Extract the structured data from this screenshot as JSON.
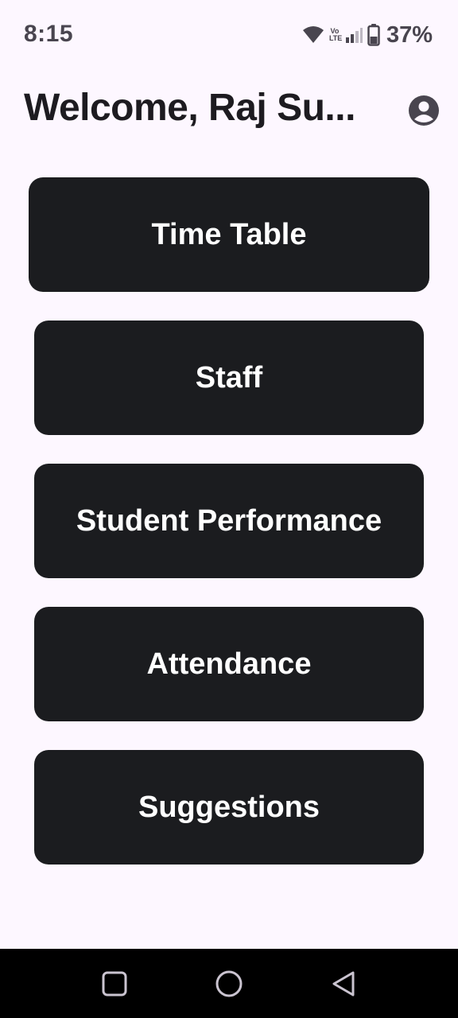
{
  "status_bar": {
    "time": "8:15",
    "volte_line1": "Vo",
    "volte_line2": "LTE",
    "battery_percent": "37%",
    "icons": [
      "wifi-icon",
      "volte-icon",
      "signal-icon",
      "battery-icon"
    ]
  },
  "header": {
    "title": "Welcome, Raj Su...",
    "account_icon": "account-circle-icon"
  },
  "menu": {
    "items": [
      {
        "label": "Time Table"
      },
      {
        "label": "Staff"
      },
      {
        "label": "Student Performance"
      },
      {
        "label": "Attendance"
      },
      {
        "label": "Suggestions"
      }
    ]
  },
  "navigation": {
    "icons": [
      "recents-icon",
      "home-icon",
      "back-icon"
    ]
  },
  "colors": {
    "background": "#fdf7ff",
    "button_background": "#1b1c1f",
    "button_text": "#ffffff",
    "title_text": "#1d1b20",
    "status_text": "#49454f",
    "nav_bar": "#000000"
  }
}
